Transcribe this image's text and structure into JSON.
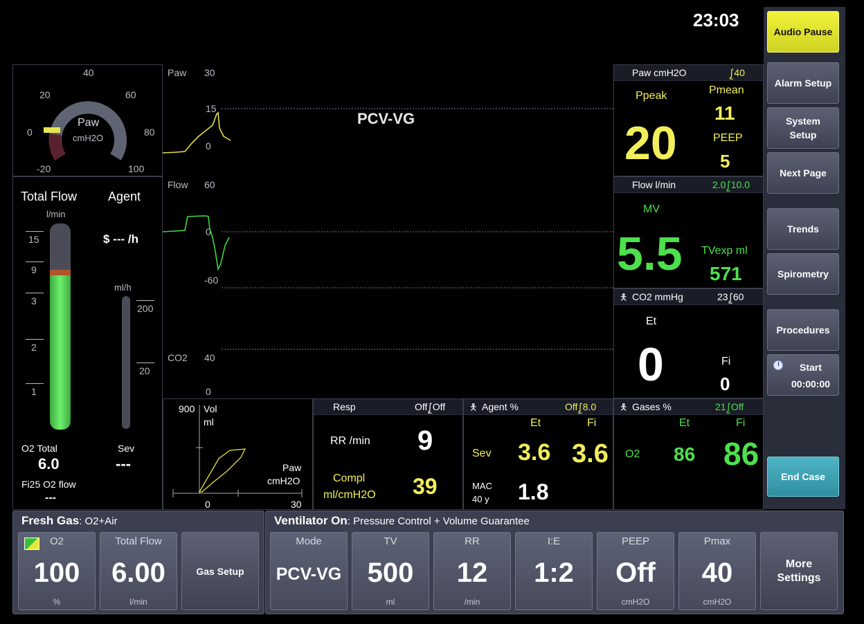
{
  "clock": "23:03",
  "side_buttons": {
    "audio_pause": "Audio Pause",
    "alarm_setup": "Alarm Setup",
    "system_setup_l1": "System",
    "system_setup_l2": "Setup",
    "next_page": "Next Page",
    "trends": "Trends",
    "spirometry": "Spirometry",
    "procedures": "Procedures",
    "start": "Start",
    "timer": "00:00:00",
    "end_case": "End Case"
  },
  "gauge": {
    "label": "Paw",
    "unit": "cmH2O",
    "ticks": [
      "40",
      "20",
      "60",
      "0",
      "80",
      "-20",
      "100"
    ],
    "value_fraction": 0.2
  },
  "flow_panel": {
    "total_flow": "Total Flow",
    "unit_lmin": "l/min",
    "agent": "Agent",
    "cost": "$ --- /h",
    "scale": [
      "15",
      "9",
      "3",
      "2",
      "1"
    ],
    "ml_h": "ml/h",
    "agent_scale": [
      "200",
      "20"
    ],
    "o2_total": "O2 Total",
    "o2_value": "6.0",
    "sev": "Sev",
    "sev_value": "---",
    "fi25": "Fi25 O2 flow",
    "fi25_value": "---",
    "o2_fill_fraction": 0.75
  },
  "waves": {
    "mode": "PCV-VG",
    "paw_label": "Paw",
    "paw_max": "30",
    "paw_mid": "15",
    "paw_zero": "0",
    "flow_label": "Flow",
    "flow_max": "60",
    "flow_zero": "0",
    "flow_min": "-60",
    "co2_label": "CO2",
    "co2_max": "40",
    "co2_zero": "0"
  },
  "loop": {
    "ymax": "900",
    "ylabel1": "Vol",
    "ylabel2": "ml",
    "xlabel1": "Paw",
    "xlabel2": "cmH2O",
    "xmin": "0",
    "xmax": "30"
  },
  "paw_num": {
    "title": "Paw cmH2O",
    "limit": "⨜40",
    "ppeak": "Ppeak",
    "ppeak_val": "20",
    "pmean": "Pmean",
    "pmean_val": "11",
    "peep": "PEEP",
    "peep_val": "5"
  },
  "flow_num": {
    "title": "Flow l/min",
    "limit": "2.0⨜10.0",
    "mv": "MV",
    "mv_val": "5.5",
    "tvexp": "TVexp ml",
    "tvexp_val": "571"
  },
  "co2_num": {
    "title": "CO2 mmHg",
    "limit": "23⨜60",
    "et": "Et",
    "et_val": "0",
    "fi": "Fi",
    "fi_val": "0"
  },
  "resp": {
    "title": "Resp",
    "limit": "Off⨜Off",
    "rr": "RR /min",
    "rr_val": "9",
    "compl1": "Compl",
    "compl2": "ml/cmH2O",
    "compl_val": "39"
  },
  "agent": {
    "title": "Agent %",
    "limit": "Off⨜8.0",
    "et": "Et",
    "fi": "Fi",
    "sev": "Sev",
    "sev_et": "3.6",
    "sev_fi": "3.6",
    "mac1": "MAC",
    "mac2": "40 y",
    "mac_val": "1.8"
  },
  "gases": {
    "title": "Gases %",
    "limit": "21⨜Off",
    "et": "Et",
    "fi": "Fi",
    "o2": "O2",
    "o2_et": "86",
    "o2_fi": "86"
  },
  "fresh_gas": {
    "title": "Fresh Gas",
    "subtitle": ": O2+Air",
    "o2_label": "O2",
    "o2_val": "100",
    "o2_unit": "%",
    "tf_label": "Total Flow",
    "tf_val": "6.00",
    "tf_unit": "l/min",
    "gas_setup": "Gas Setup"
  },
  "ventilator": {
    "title": "Ventilator On",
    "subtitle": ": Pressure Control + Volume Guarantee",
    "settings": [
      {
        "label": "Mode",
        "value": "PCV-VG",
        "unit": ""
      },
      {
        "label": "TV",
        "value": "500",
        "unit": "ml"
      },
      {
        "label": "RR",
        "value": "12",
        "unit": "/min"
      },
      {
        "label": "I:E",
        "value": "1:2",
        "unit": ""
      },
      {
        "label": "PEEP",
        "value": "Off",
        "unit": "cmH2O"
      },
      {
        "label": "Pmax",
        "value": "40",
        "unit": "cmH2O"
      }
    ],
    "more1": "More",
    "more2": "Settings"
  }
}
